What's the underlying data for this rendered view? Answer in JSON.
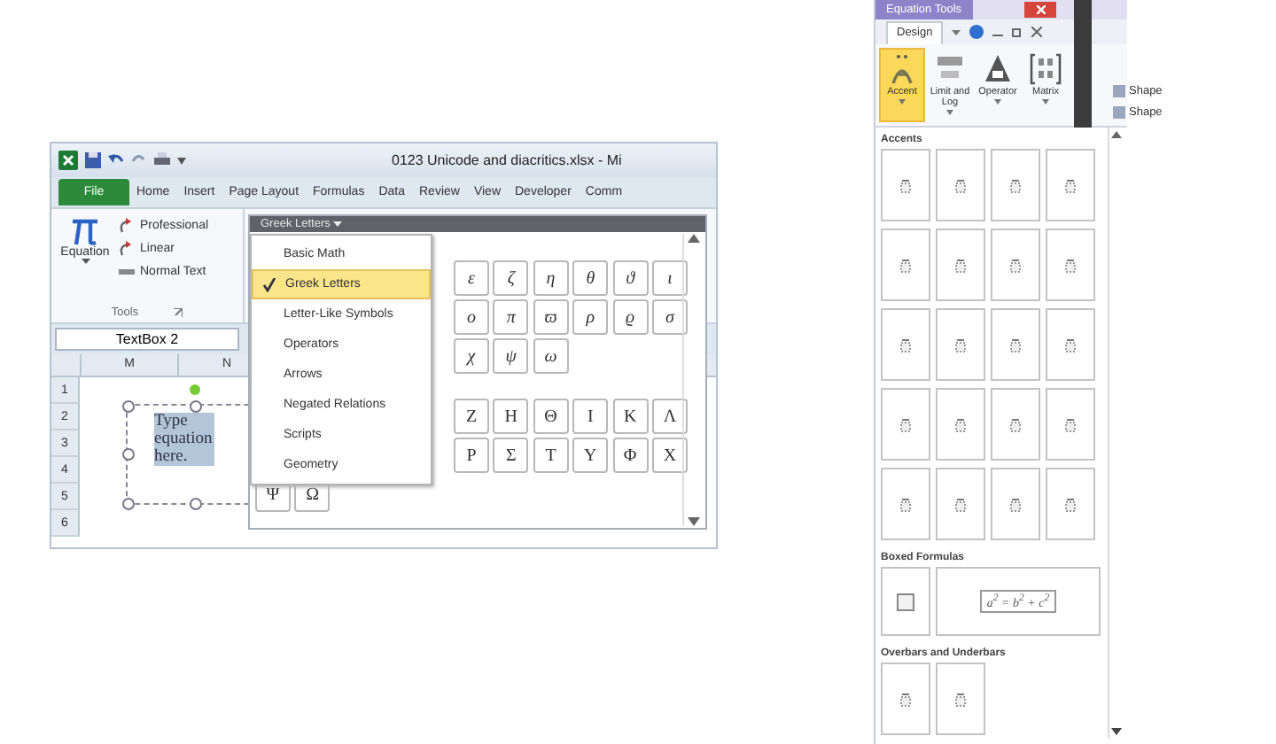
{
  "excel": {
    "title": "0123 Unicode and diacritics.xlsx - Mi",
    "tabs": [
      {
        "label": "File",
        "kind": "file"
      },
      {
        "label": "Home",
        "kind": "tab"
      },
      {
        "label": "Insert",
        "kind": "tab"
      },
      {
        "label": "Page Layout",
        "kind": "tab"
      },
      {
        "label": "Formulas",
        "kind": "tab"
      },
      {
        "label": "Data",
        "kind": "tab"
      },
      {
        "label": "Review",
        "kind": "tab"
      },
      {
        "label": "View",
        "kind": "tab"
      },
      {
        "label": "Developer",
        "kind": "tab"
      },
      {
        "label": "Comm",
        "kind": "tab"
      }
    ],
    "equation_button": "Equation",
    "options": [
      "Professional",
      "Linear",
      "Normal Text"
    ],
    "group_label": "Tools",
    "name_box": "TextBox 2",
    "columns": [
      "M",
      "N"
    ],
    "rows": [
      "1",
      "2",
      "3",
      "4",
      "5",
      "6"
    ],
    "text_box": "Type equation here.",
    "gallery": {
      "header": "Greek Letters",
      "menu": [
        {
          "label": "Basic Math",
          "selected": false
        },
        {
          "label": "Greek Letters",
          "selected": true
        },
        {
          "label": "Letter-Like Symbols",
          "selected": false
        },
        {
          "label": "Operators",
          "selected": false
        },
        {
          "label": "Arrows",
          "selected": false
        },
        {
          "label": "Negated Relations",
          "selected": false
        },
        {
          "label": "Scripts",
          "selected": false
        },
        {
          "label": "Geometry",
          "selected": false
        }
      ],
      "sections": [
        {
          "kind": "lowercase",
          "rows": [
            {
              "symbols": [
                "ε",
                "ζ",
                "η",
                "θ",
                "ϑ",
                "ι"
              ],
              "behind_menu": true
            },
            {
              "symbols": [
                "ο",
                "π",
                "ϖ",
                "ρ",
                "ϱ",
                "σ"
              ],
              "behind_menu": true
            },
            {
              "symbols": [
                "χ",
                "ψ",
                "ω"
              ],
              "behind_menu": true
            }
          ]
        },
        {
          "kind": "uppercase",
          "rows": [
            {
              "symbols": [
                "Ζ",
                "Η",
                "Θ",
                "Ι",
                "Κ",
                "Λ"
              ],
              "behind_menu": true
            },
            {
              "symbols": [
                "Ρ",
                "Σ",
                "Τ",
                "Υ",
                "Φ",
                "Χ"
              ],
              "behind_menu": true
            },
            {
              "symbols": [
                "Ψ",
                "Ω"
              ],
              "behind_menu": false
            }
          ]
        }
      ]
    }
  },
  "equation_tools": {
    "title": "Equation Tools",
    "tab": "Design",
    "buttons": [
      {
        "label": "Accent",
        "selected": true
      },
      {
        "label": "Limit and Log",
        "selected": false
      },
      {
        "label": "Operator",
        "selected": false
      },
      {
        "label": "Matrix",
        "selected": false
      }
    ],
    "sections": [
      {
        "title": "Accents",
        "kind": "grid"
      },
      {
        "title": "Boxed Formulas",
        "kind": "boxed",
        "formula": "a$^{2}$ = b$^{2}$ + c$^{2}$"
      },
      {
        "title": "Overbars and Underbars",
        "kind": "short"
      }
    ]
  },
  "side_labels": [
    "Shape",
    "Shape"
  ]
}
